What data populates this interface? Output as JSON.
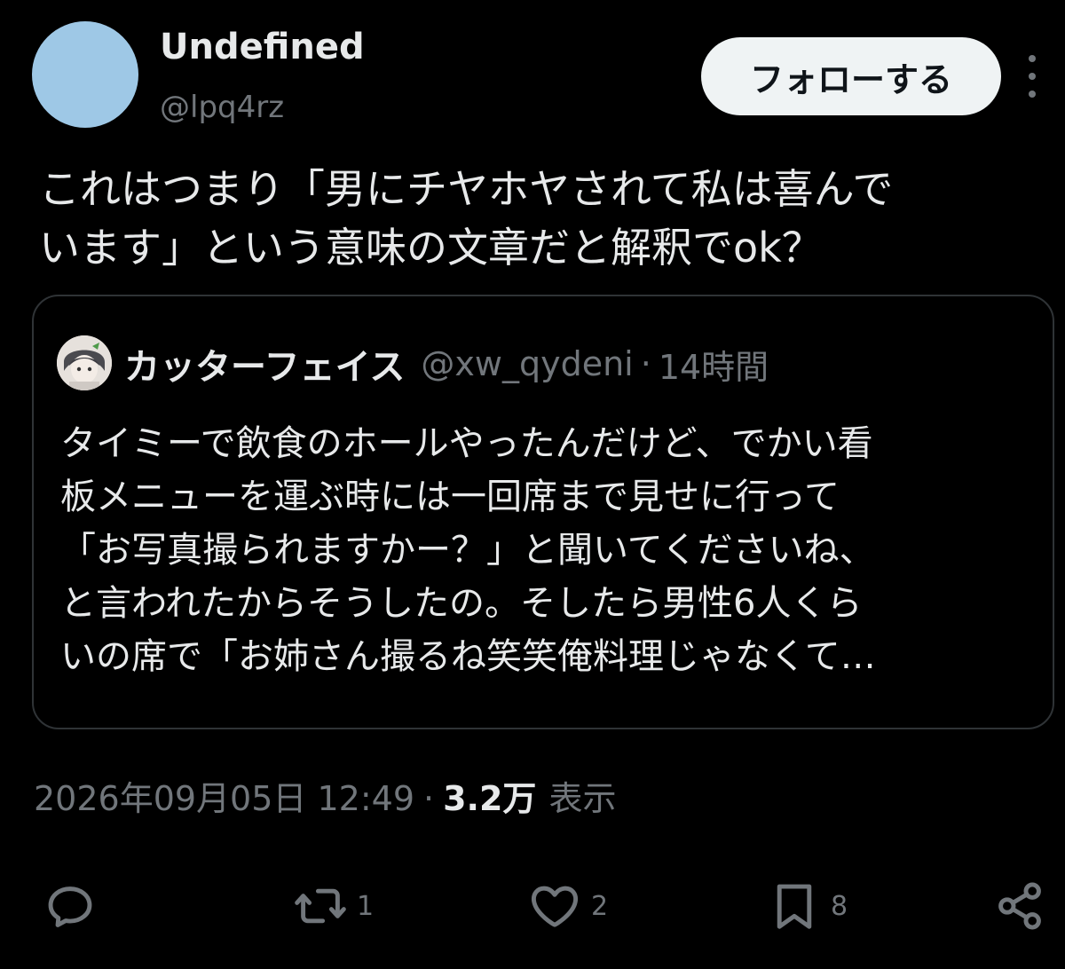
{
  "tweet": {
    "author": {
      "display_name": "Undefined",
      "handle": "@lpq4rz",
      "avatar_color": "#9ec8e6"
    },
    "follow_label": "フォローする",
    "text_lines": [
      "これはつまり「男にチヤホヤされて私は喜んで",
      "います」という意味の文章だと解釈でok？"
    ],
    "quote": {
      "name": "カッターフェイス",
      "handle": "@xw_qydeni",
      "separator": "·",
      "time": "14時間",
      "text_lines": [
        "タイミーで飲食のホールやったんだけど、でかい看",
        "板メニューを運ぶ時には一回席まで見せに行って",
        "「お写真撮られますかー？」と聞いてくださいね、",
        "と言われたからそうしたの。そしたら男性6人くら",
        "いの席で「お姉さん撮るね笑笑俺料理じゃなくて…"
      ]
    },
    "meta": {
      "datetime": "2026年09月05日 12:49",
      "separator": "·",
      "views_count": "3.2万",
      "views_label": "表示"
    },
    "actions": {
      "reply": {
        "icon": "reply-icon",
        "count": ""
      },
      "retweet": {
        "icon": "retweet-icon",
        "count": "1"
      },
      "like": {
        "icon": "heart-icon",
        "count": "2"
      },
      "bookmark": {
        "icon": "bookmark-icon",
        "count": "8"
      },
      "share": {
        "icon": "share-icon"
      }
    }
  },
  "colors": {
    "background": "#000000",
    "text_primary": "#e7e9ea",
    "text_secondary": "#71767b",
    "border": "#2f3336",
    "button_bg": "#eff3f4",
    "button_text": "#0f1419"
  }
}
